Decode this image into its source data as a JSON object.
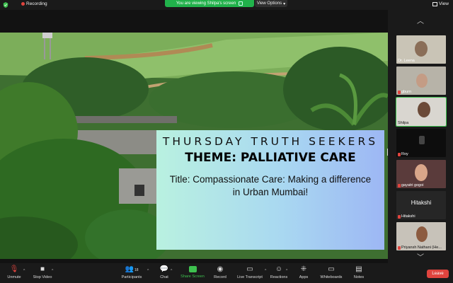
{
  "topbar": {
    "recording_label": "Recording",
    "viewing_banner": "You are viewing Shilpa's screen",
    "view_options_label": "View Options",
    "view_label": "View"
  },
  "slide": {
    "title": "THURSDAY TRUTH SEEKERS",
    "theme": "THEME: PALLIATIVE CARE",
    "subtitle": "Title: Compassionate Care: Making a difference in Urban Mumbai!"
  },
  "participants_panel": {
    "tiles": [
      {
        "name": "Dr. Leena",
        "muted": false,
        "video": true
      },
      {
        "name": "gburn",
        "muted": false,
        "video": true
      },
      {
        "name": "Shilpa",
        "muted": false,
        "video": true,
        "active": true
      },
      {
        "name": "Roy",
        "muted": true,
        "video": true
      },
      {
        "name": "gayatri gogoi",
        "muted": true,
        "video": true
      },
      {
        "name": "Hitakshi",
        "muted": true,
        "video": false,
        "center_label": "Hitakshi"
      },
      {
        "name": "Priyansh Nathani (He...",
        "muted": true,
        "video": true
      }
    ]
  },
  "toolbar": {
    "unmute": "Unmute",
    "stop_video": "Stop Video",
    "participants": "Participants",
    "participants_count": "18",
    "chat": "Chat",
    "share_screen": "Share Screen",
    "record": "Record",
    "live_transcript": "Live Transcript",
    "reactions": "Reactions",
    "apps": "Apps",
    "whiteboards": "Whiteboards",
    "notes": "Notes",
    "leave": "Leave"
  },
  "colors": {
    "accent_green": "#3ec14f",
    "leave_red": "#e0443e",
    "recording_red": "#e0443e",
    "background": "#1a1a1a"
  },
  "icons": [
    "shield-icon",
    "recording-dot-icon",
    "stop-share-icon",
    "chevron-down-icon",
    "grid-view-icon",
    "chevron-up-icon",
    "mic-muted-icon",
    "video-icon",
    "participants-icon",
    "chat-icon",
    "share-screen-icon",
    "record-icon",
    "cc-icon",
    "reactions-icon",
    "apps-icon",
    "whiteboard-icon",
    "notes-icon"
  ]
}
